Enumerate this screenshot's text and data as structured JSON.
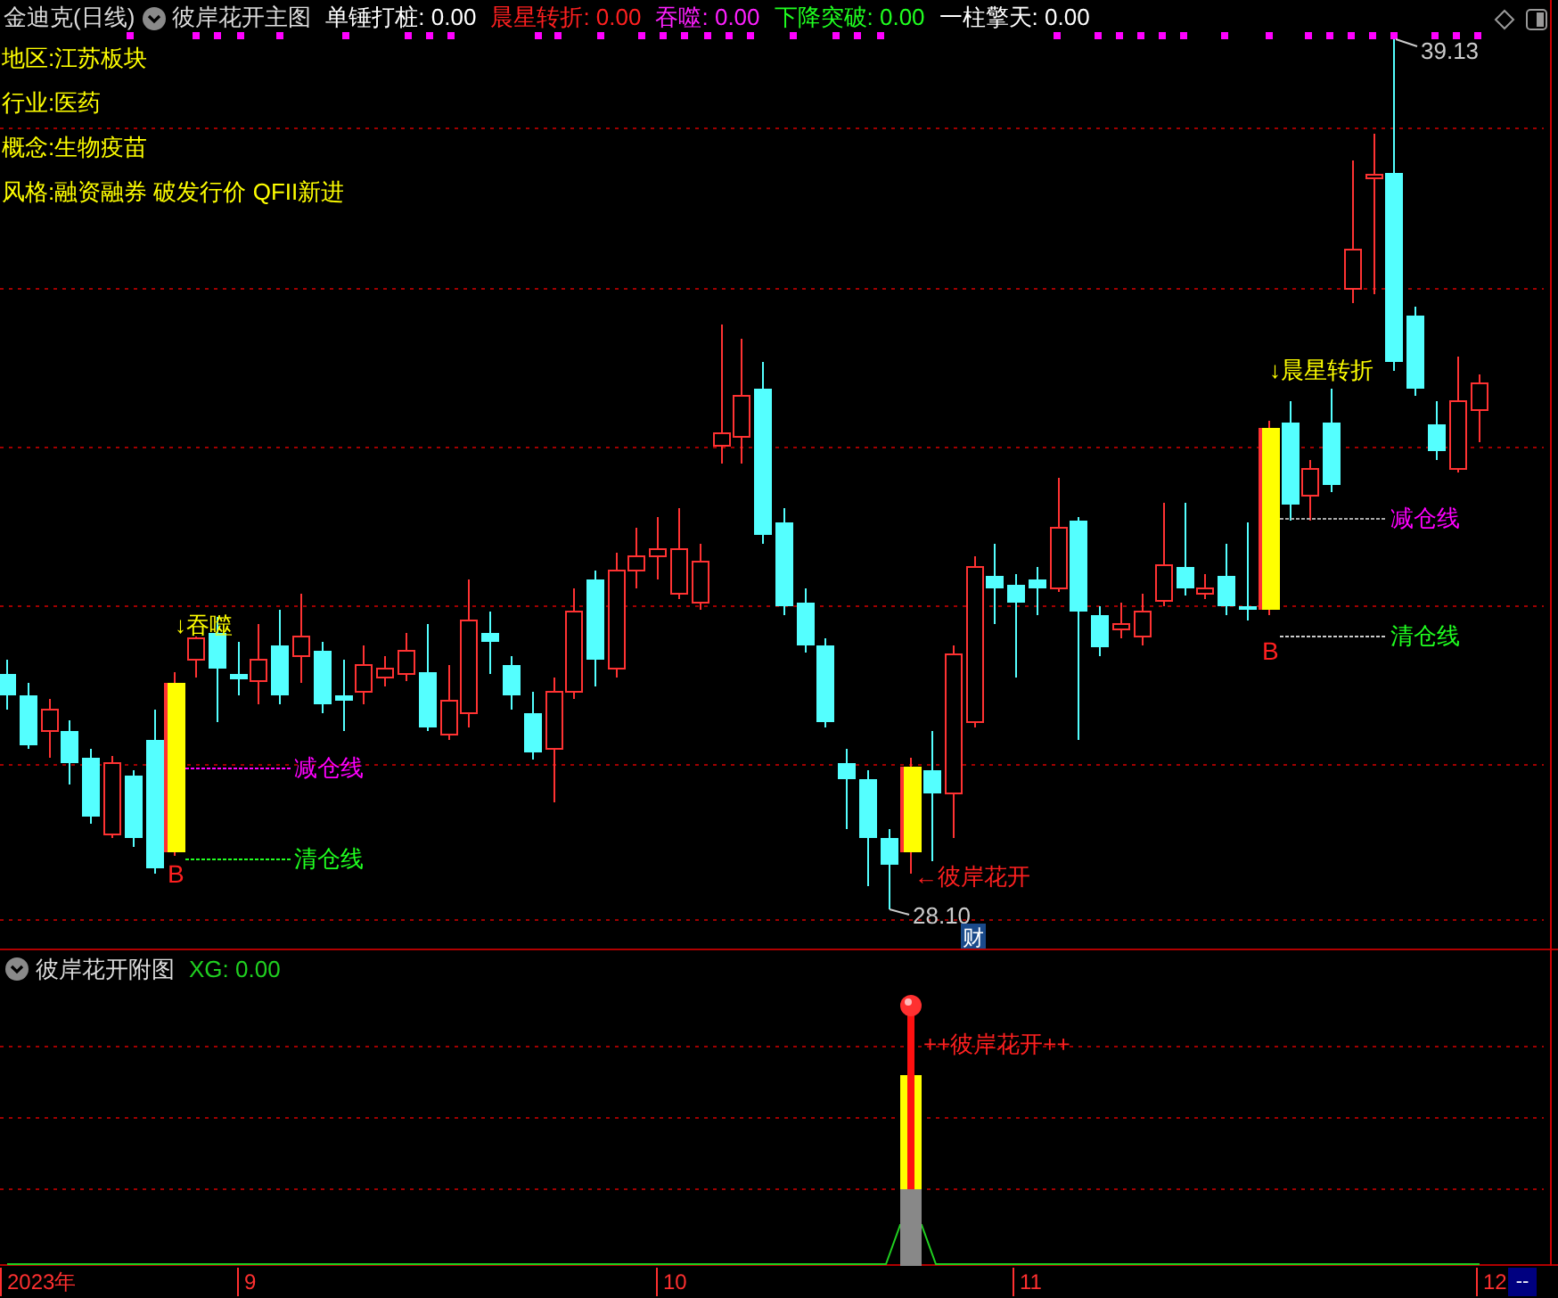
{
  "header": {
    "stock": "金迪克(日线)",
    "indicator": "彼岸花开主图"
  },
  "indicators": [
    {
      "label": "单锤打桩: 0.00",
      "color": "#ffffff"
    },
    {
      "label": "晨星转折: 0.00",
      "color": "#ff2020"
    },
    {
      "label": "吞噬: 0.00",
      "color": "#ff20ff"
    },
    {
      "label": "下降突破: 0.00",
      "color": "#20ff20"
    },
    {
      "label": "一柱擎天: 0.00",
      "color": "#ffffff"
    }
  ],
  "info_lines": [
    "地区:江苏板块",
    "行业:医药",
    "概念:生物疫苗",
    "风格:融资融券 破发行价 QFII新进"
  ],
  "main_chart": {
    "high_label": "39.13",
    "low_label": "28.10",
    "badge": "财",
    "flower_label": "←彼岸花开",
    "signals": [
      {
        "marker": "↓吞噬",
        "reduce_label": "减仓线",
        "clear_label": "清仓线",
        "buy": "B"
      },
      {
        "marker": "↓晨星转折",
        "reduce_label": "减仓线",
        "clear_label": "清仓线",
        "buy": "B"
      }
    ]
  },
  "sub_chart": {
    "title": "彼岸花开附图",
    "xg_label": "XG: 0.00",
    "signal_label": "++彼岸花开++"
  },
  "x_axis": [
    "2023年",
    "9",
    "10",
    "11",
    "12"
  ],
  "corner_label": "--"
}
